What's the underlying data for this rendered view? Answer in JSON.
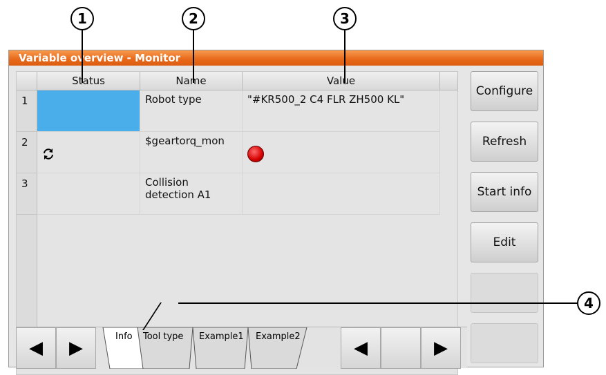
{
  "window": {
    "title": "Variable overview - Monitor"
  },
  "callouts": [
    "1",
    "2",
    "3",
    "4"
  ],
  "table": {
    "headers": [
      "Status",
      "Name",
      "Value"
    ],
    "rows": [
      {
        "num": "1",
        "name": "Robot type",
        "value": "\"#KR500_2 C4 FLR ZH500 KL\""
      },
      {
        "num": "2",
        "name": "$geartorq_mon",
        "value": ""
      },
      {
        "num": "3",
        "name": "Collision detection A1",
        "value": ""
      }
    ]
  },
  "tabs": [
    "Info",
    "Tool type",
    "Example1",
    "Example2"
  ],
  "side_buttons": [
    "Configure",
    "Refresh",
    "Start info",
    "Edit",
    "",
    ""
  ],
  "icons": {
    "row2_status": "refresh-cycle-icon",
    "row2_value": "red-led-icon",
    "nav_left": "triangle-left-icon",
    "nav_right": "triangle-right-icon"
  },
  "colors": {
    "titlebar": "#e8681a",
    "selection": "#4aaeea",
    "led": "#d40000"
  }
}
